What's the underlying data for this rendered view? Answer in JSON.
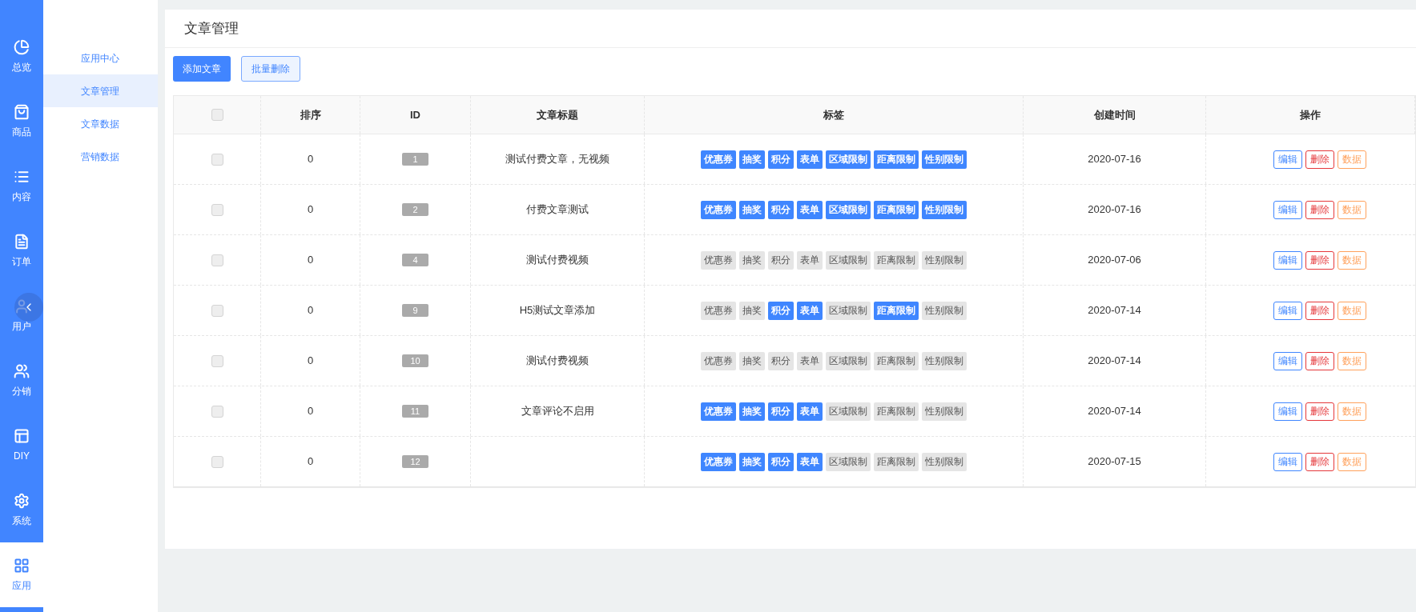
{
  "nav": [
    {
      "label": "总览",
      "selected": false
    },
    {
      "label": "商品",
      "selected": false
    },
    {
      "label": "内容",
      "selected": false
    },
    {
      "label": "订单",
      "selected": false
    },
    {
      "label": "用户",
      "selected": false
    },
    {
      "label": "分销",
      "selected": false
    },
    {
      "label": "DIY",
      "selected": false
    },
    {
      "label": "系统",
      "selected": false
    },
    {
      "label": "应用",
      "selected": true
    }
  ],
  "submenu": [
    {
      "label": "应用中心",
      "selected": false
    },
    {
      "label": "文章管理",
      "selected": true
    },
    {
      "label": "文章数据",
      "selected": false
    },
    {
      "label": "营销数据",
      "selected": false
    }
  ],
  "page_title": "文章管理",
  "actions": [
    {
      "label": "添加文章",
      "kind": "primary"
    },
    {
      "label": "批量删除",
      "kind": "secondary"
    }
  ],
  "table": {
    "select_all": {
      "checked": false
    },
    "columns": [
      "排序",
      "ID",
      "文章标题",
      "标签",
      "创建时间",
      "操作"
    ],
    "rows": [
      {
        "checked": false,
        "order": "0",
        "id": "1",
        "title": "测试付费文章，无视频",
        "tags": [
          {
            "label": "优惠券",
            "on": true
          },
          {
            "label": "抽奖",
            "on": true
          },
          {
            "label": "积分",
            "on": true
          },
          {
            "label": "表单",
            "on": true
          },
          {
            "label": "区域限制",
            "on": true
          },
          {
            "label": "距离限制",
            "on": true
          },
          {
            "label": "性别限制",
            "on": true
          }
        ],
        "created": "2020-07-16",
        "ops": [
          "编辑",
          "删除",
          "数据"
        ]
      },
      {
        "checked": false,
        "order": "0",
        "id": "2",
        "title": "付费文章测试",
        "tags": [
          {
            "label": "优惠券",
            "on": true
          },
          {
            "label": "抽奖",
            "on": true
          },
          {
            "label": "积分",
            "on": true
          },
          {
            "label": "表单",
            "on": true
          },
          {
            "label": "区域限制",
            "on": true
          },
          {
            "label": "距离限制",
            "on": true
          },
          {
            "label": "性别限制",
            "on": true
          }
        ],
        "created": "2020-07-16",
        "ops": [
          "编辑",
          "删除",
          "数据"
        ]
      },
      {
        "checked": false,
        "order": "0",
        "id": "4",
        "title": "测试付费视频",
        "tags": [
          {
            "label": "优惠券",
            "on": false
          },
          {
            "label": "抽奖",
            "on": false
          },
          {
            "label": "积分",
            "on": false
          },
          {
            "label": "表单",
            "on": false
          },
          {
            "label": "区域限制",
            "on": false
          },
          {
            "label": "距离限制",
            "on": false
          },
          {
            "label": "性别限制",
            "on": false
          }
        ],
        "created": "2020-07-06",
        "ops": [
          "编辑",
          "删除",
          "数据"
        ]
      },
      {
        "checked": false,
        "order": "0",
        "id": "9",
        "title": "H5测试文章添加",
        "tags": [
          {
            "label": "优惠券",
            "on": false
          },
          {
            "label": "抽奖",
            "on": false
          },
          {
            "label": "积分",
            "on": true
          },
          {
            "label": "表单",
            "on": true
          },
          {
            "label": "区域限制",
            "on": false
          },
          {
            "label": "距离限制",
            "on": true
          },
          {
            "label": "性别限制",
            "on": false
          }
        ],
        "created": "2020-07-14",
        "ops": [
          "编辑",
          "删除",
          "数据"
        ]
      },
      {
        "checked": false,
        "order": "0",
        "id": "10",
        "title": "测试付费视频",
        "tags": [
          {
            "label": "优惠券",
            "on": false
          },
          {
            "label": "抽奖",
            "on": false
          },
          {
            "label": "积分",
            "on": false
          },
          {
            "label": "表单",
            "on": false
          },
          {
            "label": "区域限制",
            "on": false
          },
          {
            "label": "距离限制",
            "on": false
          },
          {
            "label": "性别限制",
            "on": false
          }
        ],
        "created": "2020-07-14",
        "ops": [
          "编辑",
          "删除",
          "数据"
        ]
      },
      {
        "checked": false,
        "order": "0",
        "id": "11",
        "title": "文章评论不启用",
        "tags": [
          {
            "label": "优惠券",
            "on": true
          },
          {
            "label": "抽奖",
            "on": true
          },
          {
            "label": "积分",
            "on": true
          },
          {
            "label": "表单",
            "on": true
          },
          {
            "label": "区域限制",
            "on": false
          },
          {
            "label": "距离限制",
            "on": false
          },
          {
            "label": "性别限制",
            "on": false
          }
        ],
        "created": "2020-07-14",
        "ops": [
          "编辑",
          "删除",
          "数据"
        ]
      },
      {
        "checked": false,
        "order": "0",
        "id": "12",
        "tags": [
          {
            "label": "优惠券",
            "on": true
          },
          {
            "label": "抽奖",
            "on": true
          },
          {
            "label": "积分",
            "on": true
          },
          {
            "label": "表单",
            "on": true
          },
          {
            "label": "区域限制",
            "on": false
          },
          {
            "label": "距离限制",
            "on": false
          },
          {
            "label": "性别限制",
            "on": false
          }
        ],
        "created": "2020-07-15",
        "ops": [
          "编辑",
          "删除",
          "数据"
        ]
      }
    ]
  }
}
